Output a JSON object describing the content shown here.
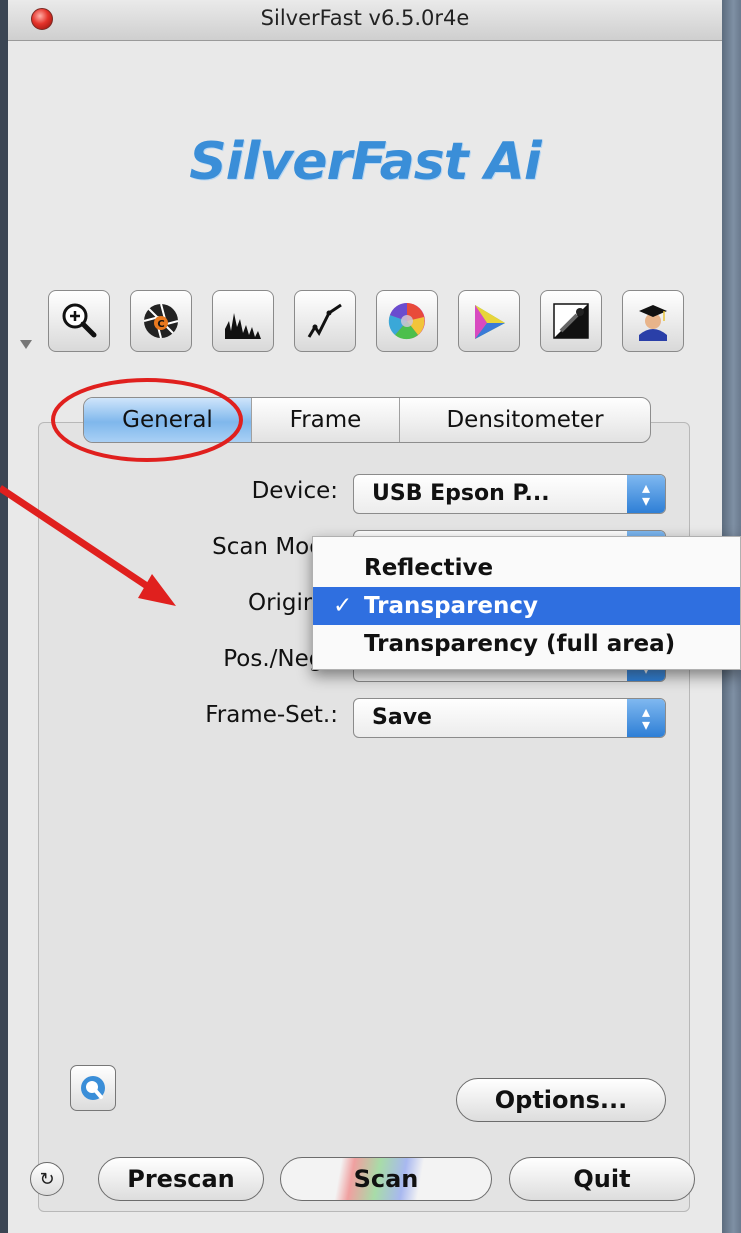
{
  "window": {
    "title": "SilverFast v6.5.0r4e"
  },
  "logo": {
    "text": "SilverFast Ai"
  },
  "toolbar": {
    "tools": [
      "magnifier-icon",
      "aperture-icon",
      "histogram-icon",
      "curve-icon",
      "color-wheel-icon",
      "gamut-icon",
      "eyedropper-icon",
      "graduate-icon"
    ]
  },
  "tabs": [
    "General",
    "Frame",
    "Densitometer"
  ],
  "active_tab": "General",
  "fields": {
    "device": {
      "label": "Device:",
      "value": "USB Epson P..."
    },
    "scan_mode": {
      "label": "Scan Mode"
    },
    "original": {
      "label": "Original"
    },
    "pos_neg": {
      "label": "Pos./Neg.."
    },
    "frame_set": {
      "label": "Frame-Set.:",
      "value": "Save"
    }
  },
  "original_menu": {
    "items": [
      "Reflective",
      "Transparency",
      "Transparency (full area)"
    ],
    "selected": "Transparency",
    "check_glyph": "✓"
  },
  "buttons": {
    "options": "Options...",
    "prescan": "Prescan",
    "scan": "Scan",
    "quit": "Quit"
  },
  "annotations": {
    "circle_color": "#e0201e",
    "arrow_color": "#e0201e"
  }
}
